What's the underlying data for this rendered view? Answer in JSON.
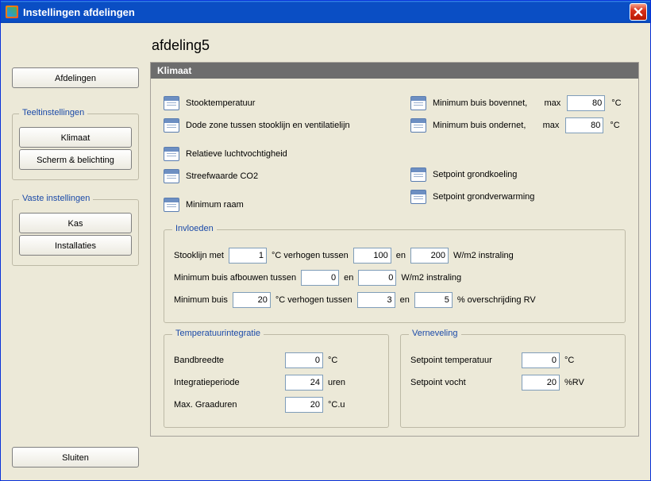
{
  "window": {
    "title": "Instellingen afdelingen"
  },
  "page_title": "afdeling5",
  "panel_header": "Klimaat",
  "sidebar": {
    "afdelingen": "Afdelingen",
    "teel_group": "Teeltinstellingen",
    "klimaat": "Klimaat",
    "scherm": "Scherm & belichting",
    "vaste_group": "Vaste instellingen",
    "kas": "Kas",
    "installaties": "Installaties",
    "sluiten": "Sluiten"
  },
  "items": {
    "stooktemp": "Stooktemperatuur",
    "dode_zone": "Dode zone tussen stooklijn en ventilatielijn",
    "rlv": "Relatieve luchtvochtigheid",
    "co2": "Streefwaarde CO2",
    "min_raam": "Minimum raam",
    "min_boven": "Minimum buis bovennet,",
    "min_onder": "Minimum buis ondernet,",
    "sp_grondkoel": "Setpoint grondkoeling",
    "sp_grondverw": "Setpoint grondverwarming",
    "max_label": "max",
    "boven_max": "80",
    "onder_max": "80",
    "unit_c": "°C"
  },
  "invloeden": {
    "title": "Invloeden",
    "l1_a": "Stooklijn met",
    "l1_val": "1",
    "l1_b": "°C verhogen tussen",
    "l1_v1": "100",
    "l1_en": "en",
    "l1_v2": "200",
    "l1_c": "W/m2 instraling",
    "l2_a": "Minimum buis afbouwen tussen",
    "l2_v1": "0",
    "l2_en": "en",
    "l2_v2": "0",
    "l2_b": "W/m2 instraling",
    "l3_a": "Minimum buis",
    "l3_val": "20",
    "l3_b": "°C verhogen tussen",
    "l3_v1": "3",
    "l3_en": "en",
    "l3_v2": "5",
    "l3_c": "% overschrijding RV"
  },
  "tempint": {
    "title": "Temperatuurintegratie",
    "bandbreedte_label": "Bandbreedte",
    "bandbreedte_val": "0",
    "bandbreedte_unit": "°C",
    "periode_label": "Integratieperiode",
    "periode_val": "24",
    "periode_unit": "uren",
    "graaduren_label": "Max. Graaduren",
    "graaduren_val": "20",
    "graaduren_unit": "°C.u"
  },
  "vernev": {
    "title": "Verneveling",
    "sp_temp_label": "Setpoint temperatuur",
    "sp_temp_val": "0",
    "sp_temp_unit": "°C",
    "sp_vocht_label": "Setpoint vocht",
    "sp_vocht_val": "20",
    "sp_vocht_unit": "%RV"
  }
}
